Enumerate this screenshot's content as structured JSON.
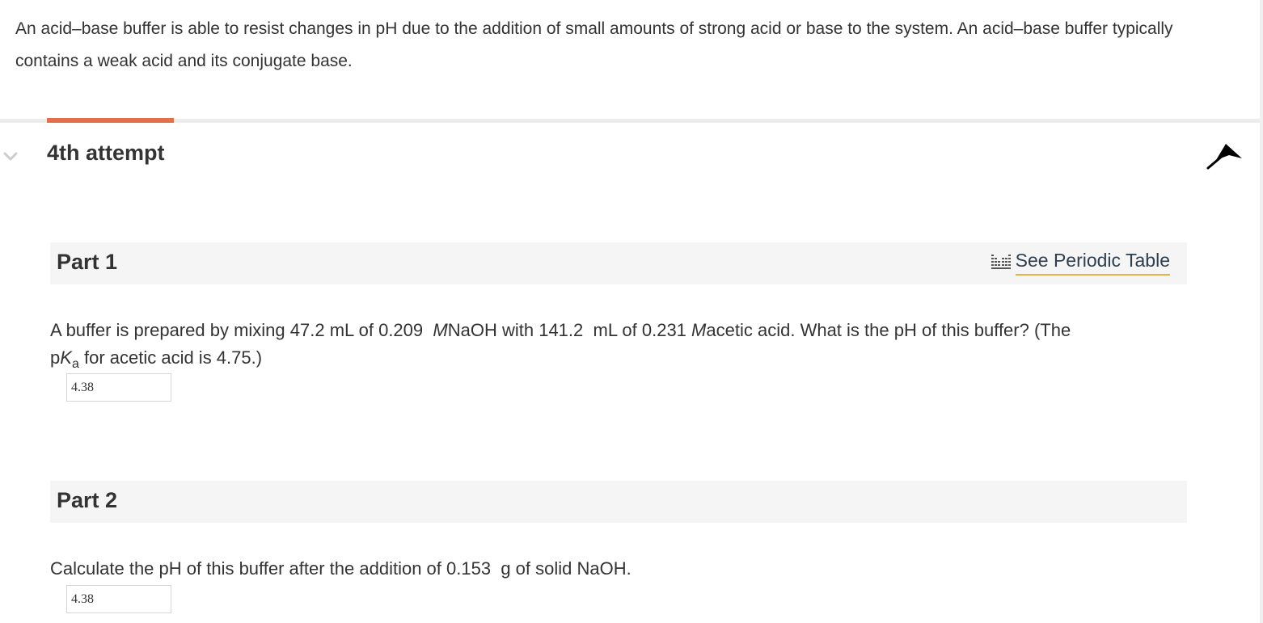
{
  "intro": {
    "text": "An acid–base buffer is able to resist changes in pH due to the addition of small amounts of strong acid or base to the system. An acid–base buffer typically contains a weak acid and its conjugate base."
  },
  "attempt": {
    "title": "4th attempt",
    "expand_icon": "chevron-down-icon",
    "collapse_icon": "collapse-arrow-icon",
    "accent_color": "#e1714b"
  },
  "part1": {
    "title": "Part 1",
    "periodic_table_link": "See Periodic Table",
    "question": {
      "lead": "A buffer is prepared by mixing ",
      "naoh_volume": "47.2",
      "unit_ml": "mL",
      "of": "of",
      "naoh_conc": "0.209",
      "molar": "M",
      "naoh": "NaOH",
      "with": "with",
      "acid_volume": "141.2",
      "acid_conc": "0.231",
      "acid": "acetic acid.",
      "ask": "What is the pH of this buffer? (The",
      "pka_p": "p",
      "pka_k": "K",
      "pka_sub": "a",
      "pka_rest": "for acetic acid is 4.75.)"
    },
    "answer": "4.38"
  },
  "part2": {
    "title": "Part 2",
    "question": {
      "lead": "Calculate the pH of this buffer after the addition of ",
      "mass": "0.153",
      "rest": "g of solid NaOH."
    },
    "answer": "4.38"
  }
}
